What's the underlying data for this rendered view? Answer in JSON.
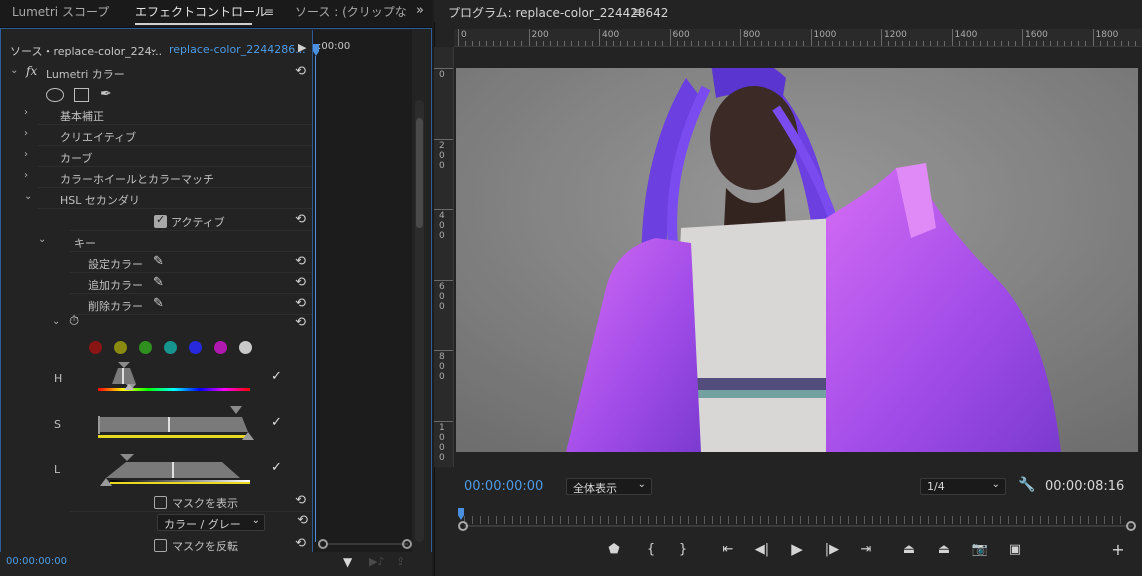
{
  "left_panel": {
    "tabs": [
      {
        "label": "Lumetri スコープ"
      },
      {
        "label": "エフェクトコントロール"
      },
      {
        "label": "ソース : (クリップな"
      }
    ],
    "menu_glyph": "≡",
    "overflow": "»",
    "source_label": "ソース・replace-color_224...",
    "clip_label": "replace-color_2244286...",
    "timeline_time": ":00:00",
    "effect_name": "Lumetri カラー",
    "sections": [
      {
        "label": "基本補正"
      },
      {
        "label": "クリエイティブ"
      },
      {
        "label": "カーブ"
      },
      {
        "label": "カラーホイールとカラーマッチ"
      },
      {
        "label": "HSL セカンダリ"
      }
    ],
    "active_label": "アクティブ",
    "key_label": "キー",
    "set_color": "設定カラー",
    "add_color": "追加カラー",
    "remove_color": "削除カラー",
    "presets": [
      "#8a1515",
      "#8a8a10",
      "#2f8f1f",
      "#16948e",
      "#2828dd",
      "#b019b0",
      "#c9c9c9"
    ],
    "hsl": {
      "h": "H",
      "s": "S",
      "l": "L"
    },
    "show_mask": "マスクを表示",
    "mask_mode": "カラー / グレー",
    "invert_mask": "マスクを反転",
    "timecode": "00:00:00:00"
  },
  "program": {
    "title": "プログラム: replace-color_224428642",
    "menu_glyph": "≡",
    "ruler_x": [
      "0",
      "200",
      "400",
      "600",
      "800",
      "1000",
      "1200",
      "1400",
      "1600",
      "1800"
    ],
    "ruler_y": [
      "0",
      "2\n0\n0",
      "4\n0\n0",
      "6\n0\n0",
      "8\n0\n0",
      "1\n0\n0\n0"
    ],
    "timecode_current": "00:00:00:00",
    "fit": "全体表示",
    "resolution": "1/4",
    "timecode_duration": "00:00:08:16"
  },
  "icons": {
    "reset": "⟲",
    "caret_right": "›",
    "caret_down": "⌄"
  }
}
